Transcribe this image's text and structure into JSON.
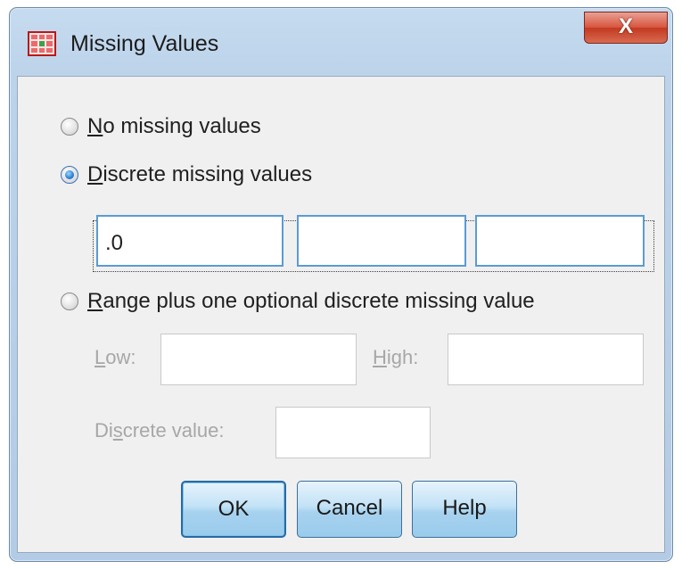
{
  "window": {
    "title": "Missing Values",
    "close_label": "X"
  },
  "options": {
    "none": {
      "pre": "",
      "mnemonic": "N",
      "post": "o missing values",
      "selected": false
    },
    "discrete": {
      "pre": "",
      "mnemonic": "D",
      "post": "iscrete missing values",
      "selected": true
    },
    "range": {
      "pre": "",
      "mnemonic": "R",
      "post": "ange plus one optional discrete missing value",
      "selected": false
    }
  },
  "discrete_values": [
    ".0",
    "",
    ""
  ],
  "range": {
    "low": {
      "pre": "",
      "mnemonic": "L",
      "post": "ow:",
      "value": ""
    },
    "high": {
      "pre": "",
      "mnemonic": "H",
      "post": "igh:",
      "value": ""
    },
    "discrete": {
      "pre": "Di",
      "mnemonic": "s",
      "post": "crete value:",
      "value": ""
    }
  },
  "buttons": {
    "ok": "OK",
    "cancel": "Cancel",
    "help": "Help"
  }
}
